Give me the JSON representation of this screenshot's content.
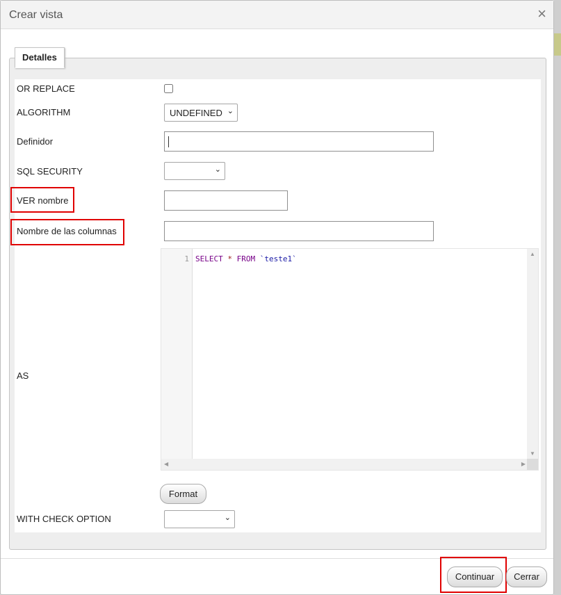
{
  "dialog": {
    "title": "Crear vista",
    "close_icon": "×"
  },
  "fieldset": {
    "legend": "Detalles"
  },
  "fields": {
    "or_replace": {
      "label": "OR REPLACE",
      "checked": false
    },
    "algorithm": {
      "label": "ALGORITHM",
      "value": "UNDEFINED"
    },
    "definer": {
      "label": "Definidor",
      "value": ""
    },
    "sql_security": {
      "label": "SQL SECURITY",
      "value": ""
    },
    "view_name": {
      "label": "VER nombre",
      "value": ""
    },
    "column_names": {
      "label": "Nombre de las columnas",
      "value": ""
    },
    "as": {
      "label": "AS"
    },
    "with_check_option": {
      "label": "WITH CHECK OPTION",
      "value": ""
    }
  },
  "editor": {
    "line_number": "1",
    "tokens": {
      "select": "SELECT",
      "star": "*",
      "from": "FROM",
      "table": "`teste1`"
    }
  },
  "buttons": {
    "format": "Format",
    "continue": "Continuar",
    "close": "Cerrar"
  },
  "highlight_color": "#e00000"
}
